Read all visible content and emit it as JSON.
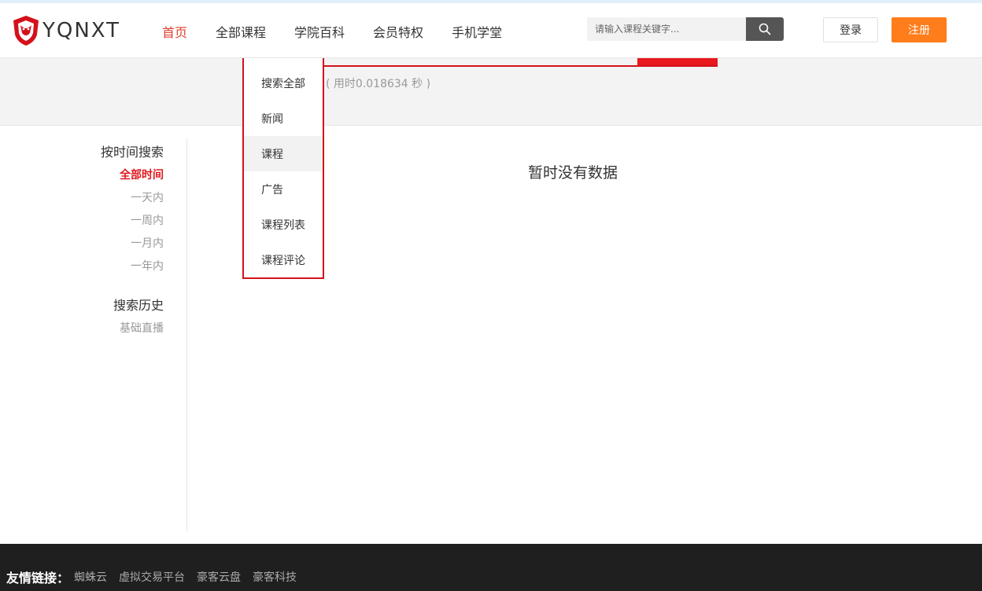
{
  "header": {
    "brand": "YQNXT",
    "nav": [
      "首页",
      "全部课程",
      "学院百科",
      "会员特权",
      "手机学堂"
    ],
    "search_placeholder": "请输入课程关键字...",
    "login": "登录",
    "register": "注册"
  },
  "result_meta": {
    "timing": "( 用时0.018634 秒 )"
  },
  "search_type_dropdown": {
    "items": [
      "搜索全部",
      "新闻",
      "课程",
      "广告",
      "课程列表",
      "课程评论"
    ],
    "highlighted": "课程"
  },
  "sidebar": {
    "time_filter_title": "按时间搜索",
    "time_filters": [
      "全部时间",
      "一天内",
      "一周内",
      "一月内",
      "一年内"
    ],
    "active_filter": "全部时间",
    "history_title": "搜索历史",
    "history": [
      "基础直播"
    ]
  },
  "main": {
    "empty_message": "暂时没有数据"
  },
  "footer": {
    "links_title": "友情链接：",
    "links": [
      "蜘蛛云",
      "虚拟交易平台",
      "豪客云盘",
      "豪客科技"
    ]
  },
  "colors": {
    "accent_red": "#e0191f",
    "register_orange": "#ff7d1a",
    "footer_bg": "#1f1f1f"
  }
}
